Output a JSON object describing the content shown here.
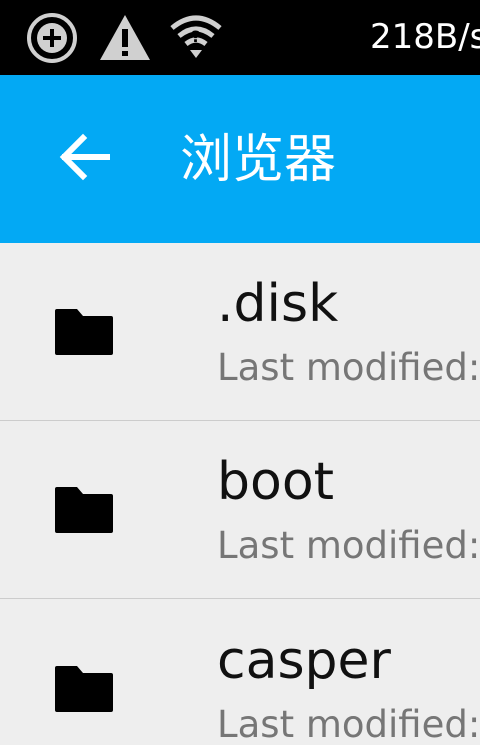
{
  "status_bar": {
    "icons": [
      "add-circle-icon",
      "warning-icon",
      "wifi-question-icon"
    ],
    "network_speed": "218B/s"
  },
  "app_bar": {
    "back_icon": "arrow-back-icon",
    "title": "浏览器"
  },
  "files": [
    {
      "name": ".disk",
      "meta": "Last modified:",
      "icon": "folder-icon"
    },
    {
      "name": "boot",
      "meta": "Last modified:",
      "icon": "folder-icon"
    },
    {
      "name": "casper",
      "meta": "Last modified:",
      "icon": "folder-icon"
    }
  ],
  "colors": {
    "status_bar_bg": "#000000",
    "app_bar_bg": "#03a9f4",
    "list_bg": "#eeeeee",
    "meta_text": "#767676",
    "divider": "#cccccc"
  }
}
